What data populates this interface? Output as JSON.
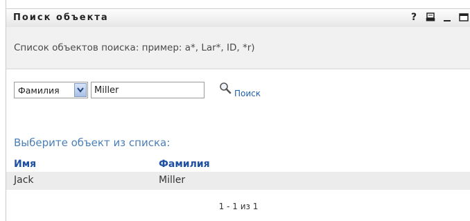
{
  "window": {
    "title": "Поиск объекта",
    "controls": [
      {
        "name": "help-icon",
        "glyph": "?"
      },
      {
        "name": "print-icon",
        "glyph": ""
      },
      {
        "name": "minimize-icon",
        "glyph": "_"
      },
      {
        "name": "maximize-icon",
        "glyph": ""
      }
    ]
  },
  "hint": "Список объектов поиска: пример: a*, Lar*, ID, *r)",
  "search": {
    "field_select": "Фамилия",
    "query": "Miller",
    "button_label": "Поиск"
  },
  "results": {
    "prompt": "Выберите объект из списка:",
    "columns": [
      "Имя",
      "Фамилия"
    ],
    "rows": [
      [
        "Jack",
        "Miller"
      ]
    ],
    "pager": "1 - 1 из 1"
  },
  "colors": {
    "link": "#1d4fa3",
    "prompt": "#4a7eb8",
    "row_bg": "#ececec"
  }
}
